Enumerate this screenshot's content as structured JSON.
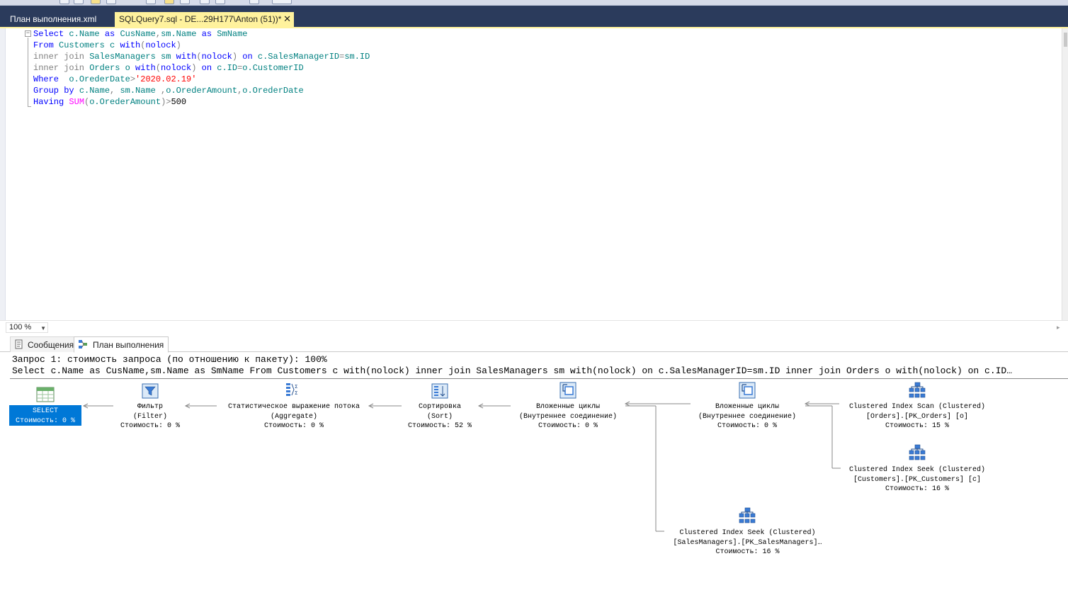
{
  "tabs": [
    {
      "label": "План выполнения.xml"
    },
    {
      "label": "SQLQuery7.sql - DE...29H177\\Anton (51))*",
      "close": "✕"
    }
  ],
  "editor": {
    "lines": [
      [
        {
          "t": "Select ",
          "c": "kw"
        },
        {
          "t": "c.Name ",
          "c": "tx"
        },
        {
          "t": "as ",
          "c": "kw"
        },
        {
          "t": "CusName",
          "c": "tx"
        },
        {
          "t": ",",
          "c": "gr"
        },
        {
          "t": "sm.Name ",
          "c": "tx"
        },
        {
          "t": "as ",
          "c": "kw"
        },
        {
          "t": "SmName",
          "c": "tx"
        }
      ],
      [
        {
          "t": "From ",
          "c": "kw"
        },
        {
          "t": "Customers c ",
          "c": "tx"
        },
        {
          "t": "with",
          "c": "kw"
        },
        {
          "t": "(",
          "c": "gr"
        },
        {
          "t": "nolock",
          "c": "kw"
        },
        {
          "t": ")",
          "c": "gr"
        }
      ],
      [
        {
          "t": "inner join ",
          "c": "gr"
        },
        {
          "t": "SalesManagers sm ",
          "c": "tx"
        },
        {
          "t": "with",
          "c": "kw"
        },
        {
          "t": "(",
          "c": "gr"
        },
        {
          "t": "nolock",
          "c": "kw"
        },
        {
          "t": ") ",
          "c": "gr"
        },
        {
          "t": "on ",
          "c": "kw"
        },
        {
          "t": "c.SalesManagerID",
          "c": "tx"
        },
        {
          "t": "=",
          "c": "gr"
        },
        {
          "t": "sm.ID",
          "c": "tx"
        }
      ],
      [
        {
          "t": "inner join ",
          "c": "gr"
        },
        {
          "t": "Orders o ",
          "c": "tx"
        },
        {
          "t": "with",
          "c": "kw"
        },
        {
          "t": "(",
          "c": "gr"
        },
        {
          "t": "nolock",
          "c": "kw"
        },
        {
          "t": ") ",
          "c": "gr"
        },
        {
          "t": "on ",
          "c": "kw"
        },
        {
          "t": "c.ID",
          "c": "tx"
        },
        {
          "t": "=",
          "c": "gr"
        },
        {
          "t": "o.CustomerID",
          "c": "tx"
        }
      ],
      [
        {
          "t": "Where  ",
          "c": "kw"
        },
        {
          "t": "o.OrederDate",
          "c": "tx"
        },
        {
          "t": ">",
          "c": "gr"
        },
        {
          "t": "'2020.02.19'",
          "c": "st"
        }
      ],
      [
        {
          "t": "Group by ",
          "c": "kw"
        },
        {
          "t": "c.Name",
          "c": "tx"
        },
        {
          "t": ", ",
          "c": "gr"
        },
        {
          "t": "sm.Name ",
          "c": "tx"
        },
        {
          "t": ",",
          "c": "gr"
        },
        {
          "t": "o.OrederAmount",
          "c": "tx"
        },
        {
          "t": ",",
          "c": "gr"
        },
        {
          "t": "o.OrederDate",
          "c": "tx"
        }
      ],
      [
        {
          "t": "Having ",
          "c": "kw"
        },
        {
          "t": "SUM",
          "c": "fn"
        },
        {
          "t": "(",
          "c": "gr"
        },
        {
          "t": "o.OrederAmount",
          "c": "tx"
        },
        {
          "t": ")",
          "c": "gr"
        },
        {
          "t": ">",
          "c": "gr"
        },
        {
          "t": "500",
          "c": "pl"
        }
      ]
    ]
  },
  "zoom": {
    "value": "100 %"
  },
  "result_tabs": {
    "messages": "Сообщения",
    "plan": "План выполнения"
  },
  "plan": {
    "header": "Запрос 1: стоимость запроса (по отношению к пакету): 100%",
    "query": "Select c.Name as CusName,sm.Name as SmName From Customers c with(nolock) inner join SalesManagers sm with(nolock) on c.SalesManagerID=sm.ID inner join Orders o with(nolock) on c.ID…",
    "nodes": {
      "select": {
        "name": "SELECT",
        "cost": "Стоимость: 0 %"
      },
      "filter": {
        "name": "Фильтр",
        "sub": "(Filter)",
        "cost": "Стоимость: 0 %"
      },
      "aggregate": {
        "name": "Статистическое выражение потока",
        "sub": "(Aggregate)",
        "cost": "Стоимость: 0 %"
      },
      "sort": {
        "name": "Сортировка",
        "sub": "(Sort)",
        "cost": "Стоимость: 52 %"
      },
      "nested1": {
        "name": "Вложенные циклы",
        "sub": "(Внутреннее соединение)",
        "cost": "Стоимость: 0 %"
      },
      "nested2": {
        "name": "Вложенные циклы",
        "sub": "(Внутреннее соединение)",
        "cost": "Стоимость: 0 %"
      },
      "scan_orders": {
        "name": "Clustered Index Scan (Clustered)",
        "sub": "[Orders].[PK_Orders] [o]",
        "cost": "Стоимость: 15 %"
      },
      "seek_customers": {
        "name": "Clustered Index Seek (Clustered)",
        "sub": "[Customers].[PK_Customers] [c]",
        "cost": "Стоимость: 16 %"
      },
      "seek_sales": {
        "name": "Clustered Index Seek (Clustered)",
        "sub": "[SalesManagers].[PK_SalesManagers]…",
        "cost": "Стоимость: 16 %"
      }
    },
    "icons": {
      "select": "table-grid-icon",
      "filter": "filter-icon",
      "aggregate": "stream-aggregate-icon",
      "sort": "sort-icon",
      "nested": "nested-loops-icon",
      "index": "clustered-index-icon"
    }
  },
  "colors": {
    "tabbar": "#2b3b5c",
    "active_tab": "#fff29d",
    "selected_node": "#0078d7",
    "keyword": "#0000ff",
    "identifier": "#008080",
    "string": "#ff0000",
    "function": "#ff00ff",
    "operator": "#808080"
  }
}
